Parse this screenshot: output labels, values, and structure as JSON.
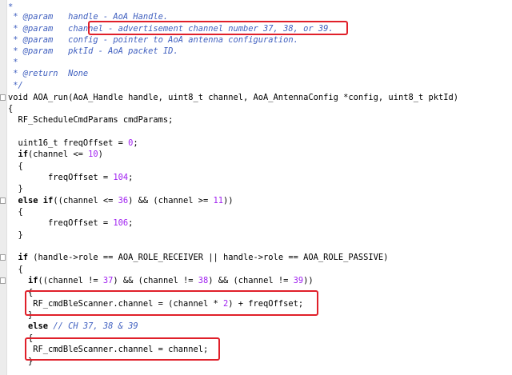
{
  "editor": {
    "lines": [
      {
        "segments": [
          {
            "t": "*",
            "c": "c"
          }
        ]
      },
      {
        "segments": [
          {
            "t": " * @param   handle - AoA Handle.",
            "c": "c"
          }
        ]
      },
      {
        "segments": [
          {
            "t": " * @param   channel - advertisement channel number 37, 38, or 39.",
            "c": "c"
          }
        ]
      },
      {
        "segments": [
          {
            "t": " * @param   config - pointer to AoA antenna configuration.",
            "c": "c"
          }
        ]
      },
      {
        "segments": [
          {
            "t": " * @param   pktId - AoA packet ID.",
            "c": "c"
          }
        ]
      },
      {
        "segments": [
          {
            "t": " *",
            "c": "c"
          }
        ]
      },
      {
        "segments": [
          {
            "t": " * @return  None",
            "c": "c"
          }
        ]
      },
      {
        "segments": [
          {
            "t": " */",
            "c": "c"
          }
        ]
      },
      {
        "fold": true,
        "segments": [
          {
            "t": "void AOA_run(AoA_Handle handle, uint8_t channel, AoA_AntennaConfig *config, uint8_t pktId)",
            "c": ""
          }
        ]
      },
      {
        "segments": [
          {
            "t": "{",
            "c": ""
          }
        ]
      },
      {
        "segments": [
          {
            "t": "  RF_ScheduleCmdParams cmdParams;",
            "c": ""
          }
        ]
      },
      {
        "segments": [
          {
            "t": "",
            "c": ""
          }
        ]
      },
      {
        "segments": [
          {
            "t": "  uint16_t freqOffset = ",
            "c": ""
          },
          {
            "t": "0",
            "c": "n"
          },
          {
            "t": ";",
            "c": ""
          }
        ]
      },
      {
        "segments": [
          {
            "t": "  ",
            "c": ""
          },
          {
            "t": "if",
            "c": "k"
          },
          {
            "t": "(channel <= ",
            "c": ""
          },
          {
            "t": "10",
            "c": "n"
          },
          {
            "t": ")",
            "c": ""
          }
        ]
      },
      {
        "segments": [
          {
            "t": "  {",
            "c": ""
          }
        ]
      },
      {
        "segments": [
          {
            "t": "        freqOffset = ",
            "c": ""
          },
          {
            "t": "104",
            "c": "n"
          },
          {
            "t": ";",
            "c": ""
          }
        ]
      },
      {
        "segments": [
          {
            "t": "  }",
            "c": ""
          }
        ]
      },
      {
        "fold": true,
        "segments": [
          {
            "t": "  ",
            "c": ""
          },
          {
            "t": "else if",
            "c": "k"
          },
          {
            "t": "((channel <= ",
            "c": ""
          },
          {
            "t": "36",
            "c": "n"
          },
          {
            "t": ") && (channel >= ",
            "c": ""
          },
          {
            "t": "11",
            "c": "n"
          },
          {
            "t": "))",
            "c": ""
          }
        ]
      },
      {
        "segments": [
          {
            "t": "  {",
            "c": ""
          }
        ]
      },
      {
        "segments": [
          {
            "t": "        freqOffset = ",
            "c": ""
          },
          {
            "t": "106",
            "c": "n"
          },
          {
            "t": ";",
            "c": ""
          }
        ]
      },
      {
        "segments": [
          {
            "t": "  }",
            "c": ""
          }
        ]
      },
      {
        "segments": [
          {
            "t": "",
            "c": ""
          }
        ]
      },
      {
        "fold": true,
        "segments": [
          {
            "t": "  ",
            "c": ""
          },
          {
            "t": "if",
            "c": "k"
          },
          {
            "t": " (handle->role == AOA_ROLE_RECEIVER || handle->role == AOA_ROLE_PASSIVE)",
            "c": ""
          }
        ]
      },
      {
        "segments": [
          {
            "t": "  {",
            "c": ""
          }
        ]
      },
      {
        "fold": true,
        "segments": [
          {
            "t": "    ",
            "c": ""
          },
          {
            "t": "if",
            "c": "k"
          },
          {
            "t": "((channel != ",
            "c": ""
          },
          {
            "t": "37",
            "c": "n"
          },
          {
            "t": ") && (channel != ",
            "c": ""
          },
          {
            "t": "38",
            "c": "n"
          },
          {
            "t": ") && (channel != ",
            "c": ""
          },
          {
            "t": "39",
            "c": "n"
          },
          {
            "t": "))",
            "c": ""
          }
        ]
      },
      {
        "segments": [
          {
            "t": "    {",
            "c": ""
          }
        ]
      },
      {
        "segments": [
          {
            "t": "     RF_cmdBleScanner.channel = (channel * ",
            "c": ""
          },
          {
            "t": "2",
            "c": "n"
          },
          {
            "t": ") + freqOffset;",
            "c": ""
          }
        ]
      },
      {
        "segments": [
          {
            "t": "    }",
            "c": ""
          }
        ]
      },
      {
        "segments": [
          {
            "t": "    ",
            "c": ""
          },
          {
            "t": "else",
            "c": "k"
          },
          {
            "t": " ",
            "c": ""
          },
          {
            "t": "// CH 37, 38 & 39",
            "c": "c"
          }
        ]
      },
      {
        "segments": [
          {
            "t": "    {",
            "c": ""
          }
        ]
      },
      {
        "segments": [
          {
            "t": "     RF_cmdBleScanner.channel = channel;",
            "c": ""
          }
        ]
      },
      {
        "segments": [
          {
            "t": "    }",
            "c": ""
          }
        ]
      }
    ]
  },
  "highlights": [
    {
      "label": "channel-description-highlight"
    },
    {
      "label": "channel-offset-highlight"
    },
    {
      "label": "channel-assign-highlight"
    }
  ],
  "colors": {
    "comment": "#3f5fbf",
    "number": "#a020f0",
    "keyword": "#000000",
    "highlight": "#e0202a"
  }
}
